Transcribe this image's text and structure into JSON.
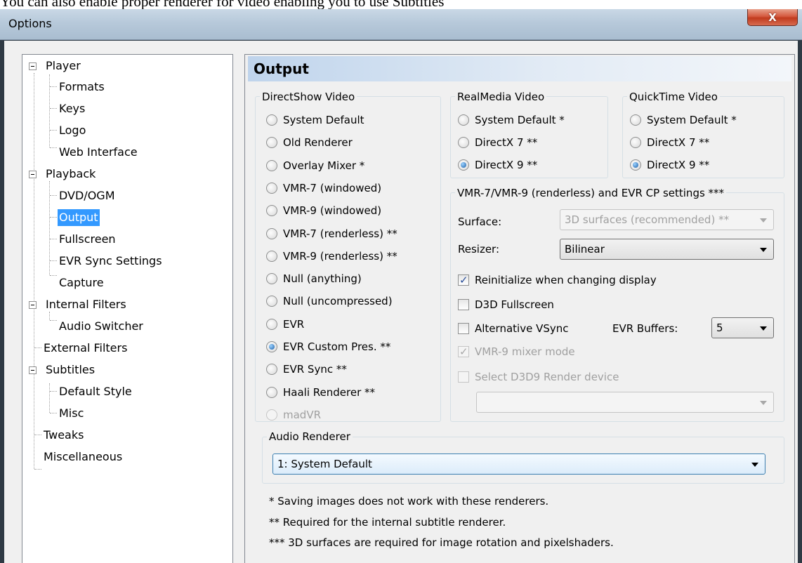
{
  "caption": "You can also enable proper renderer for video enabling you to use Subtitles",
  "window": {
    "title": "Options",
    "close_label": "X"
  },
  "tree": {
    "items": [
      {
        "label": "Player",
        "level": 0,
        "expander": true
      },
      {
        "label": "Formats",
        "level": 1
      },
      {
        "label": "Keys",
        "level": 1
      },
      {
        "label": "Logo",
        "level": 1
      },
      {
        "label": "Web Interface",
        "level": 1
      },
      {
        "label": "Playback",
        "level": 0,
        "expander": true
      },
      {
        "label": "DVD/OGM",
        "level": 1
      },
      {
        "label": "Output",
        "level": 1,
        "selected": true
      },
      {
        "label": "Fullscreen",
        "level": 1
      },
      {
        "label": "EVR Sync Settings",
        "level": 1
      },
      {
        "label": "Capture",
        "level": 1
      },
      {
        "label": "Internal Filters",
        "level": 0,
        "expander": true
      },
      {
        "label": "Audio Switcher",
        "level": 1
      },
      {
        "label": "External Filters",
        "level": 0
      },
      {
        "label": "Subtitles",
        "level": 0,
        "expander": true
      },
      {
        "label": "Default Style",
        "level": 1
      },
      {
        "label": "Misc",
        "level": 1
      },
      {
        "label": "Tweaks",
        "level": 0
      },
      {
        "label": "Miscellaneous",
        "level": 0
      }
    ]
  },
  "page": {
    "title": "Output"
  },
  "directshow": {
    "title": "DirectShow Video",
    "options": [
      {
        "label": "System Default",
        "checked": false,
        "disabled": false
      },
      {
        "label": "Old Renderer",
        "checked": false,
        "disabled": false
      },
      {
        "label": "Overlay Mixer *",
        "checked": false,
        "disabled": false
      },
      {
        "label": "VMR-7 (windowed)",
        "checked": false,
        "disabled": false
      },
      {
        "label": "VMR-9 (windowed)",
        "checked": false,
        "disabled": false
      },
      {
        "label": "VMR-7 (renderless) **",
        "checked": false,
        "disabled": false
      },
      {
        "label": "VMR-9 (renderless) **",
        "checked": false,
        "disabled": false
      },
      {
        "label": "Null (anything)",
        "checked": false,
        "disabled": false
      },
      {
        "label": "Null (uncompressed)",
        "checked": false,
        "disabled": false
      },
      {
        "label": "EVR",
        "checked": false,
        "disabled": false
      },
      {
        "label": "EVR Custom Pres. **",
        "checked": true,
        "disabled": false
      },
      {
        "label": "EVR Sync **",
        "checked": false,
        "disabled": false
      },
      {
        "label": "Haali Renderer **",
        "checked": false,
        "disabled": false
      },
      {
        "label": "madVR",
        "checked": false,
        "disabled": true
      }
    ]
  },
  "realmedia": {
    "title": "RealMedia Video",
    "options": [
      {
        "label": "System Default *",
        "checked": false
      },
      {
        "label": "DirectX 7 **",
        "checked": false
      },
      {
        "label": "DirectX 9 **",
        "checked": true
      }
    ]
  },
  "quicktime": {
    "title": "QuickTime Video",
    "options": [
      {
        "label": "System Default *",
        "checked": false
      },
      {
        "label": "DirectX 7 **",
        "checked": false
      },
      {
        "label": "DirectX 9 **",
        "checked": true
      }
    ]
  },
  "vmr": {
    "title": "VMR-7/VMR-9 (renderless) and EVR CP settings ***",
    "surface_label": "Surface:",
    "surface_value": "3D surfaces (recommended) **",
    "resizer_label": "Resizer:",
    "resizer_value": "Bilinear",
    "reinit_label": "Reinitialize when changing display",
    "reinit_checked": true,
    "d3d_label": "D3D Fullscreen",
    "d3d_checked": false,
    "altvsync_label": "Alternative VSync",
    "altvsync_checked": false,
    "evr_buffers_label": "EVR Buffers:",
    "evr_buffers_value": "5",
    "mixer_label": "VMR-9 mixer mode",
    "mixer_checked": true,
    "select_device_label": "Select D3D9 Render device",
    "select_device_checked": false,
    "device_value": ""
  },
  "audio": {
    "title": "Audio Renderer",
    "value": "1: System Default"
  },
  "footnotes": [
    "* Saving images does not work with these renderers.",
    "** Required for the internal subtitle renderer.",
    "*** 3D surfaces are required for image rotation and pixelshaders."
  ]
}
